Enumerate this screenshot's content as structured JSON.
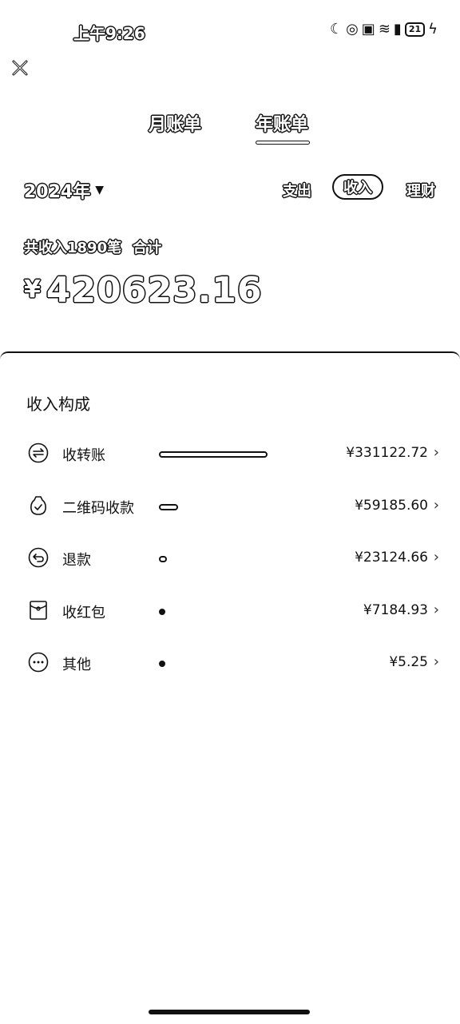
{
  "status_bar": {
    "time": "上午9:26",
    "battery": "21"
  },
  "tabs": [
    {
      "label": "月账单",
      "selected": false
    },
    {
      "label": "年账单",
      "selected": true
    }
  ],
  "filter": {
    "year": "2024年",
    "segments": [
      {
        "label": "支出",
        "selected": false
      },
      {
        "label": "收入",
        "selected": true
      },
      {
        "label": "理财",
        "selected": false
      }
    ]
  },
  "summary": {
    "count_text": "共收入1890笔",
    "total_label": "合计",
    "currency": "¥",
    "total": "420623.16"
  },
  "composition": {
    "title": "收入构成",
    "items": [
      {
        "icon": "transfer-icon",
        "label": "收转账",
        "amount": "¥331122.72",
        "share": 0.787
      },
      {
        "icon": "qr-payment-icon",
        "label": "二维码收款",
        "amount": "¥59185.60",
        "share": 0.141
      },
      {
        "icon": "refund-icon",
        "label": "退款",
        "amount": "¥23124.66",
        "share": 0.055
      },
      {
        "icon": "red-packet-icon",
        "label": "收红包",
        "amount": "¥7184.93",
        "share": 0.017
      },
      {
        "icon": "more-icon",
        "label": "其他",
        "amount": "¥5.25",
        "share": 0.0
      }
    ]
  }
}
